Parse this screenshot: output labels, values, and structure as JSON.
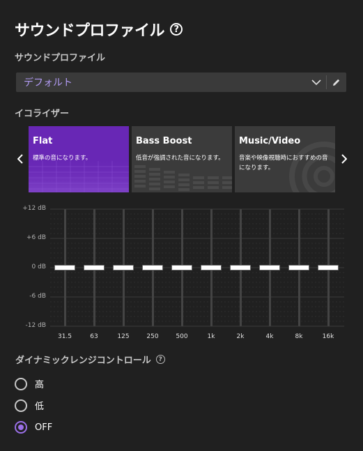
{
  "header": {
    "title": "サウンドプロファイル"
  },
  "profile": {
    "label": "サウンドプロファイル",
    "selected": "デフォルト"
  },
  "equalizer": {
    "label": "イコライザー",
    "presets": [
      {
        "name": "Flat",
        "desc": "標準の音になります。",
        "active": true
      },
      {
        "name": "Bass Boost",
        "desc": "低音が強調された音になります。",
        "active": false
      },
      {
        "name": "Music/Video",
        "desc": "音楽や映像視聴時におすすめの音になります。",
        "active": false
      }
    ],
    "y_ticks": [
      "+12 dB",
      "+6 dB",
      "0 dB",
      "-6 dB",
      "-12 dB"
    ],
    "bands": [
      {
        "freq": "31.5",
        "gain_db": 0
      },
      {
        "freq": "63",
        "gain_db": 0
      },
      {
        "freq": "125",
        "gain_db": 0
      },
      {
        "freq": "250",
        "gain_db": 0
      },
      {
        "freq": "500",
        "gain_db": 0
      },
      {
        "freq": "1k",
        "gain_db": 0
      },
      {
        "freq": "2k",
        "gain_db": 0
      },
      {
        "freq": "4k",
        "gain_db": 0
      },
      {
        "freq": "8k",
        "gain_db": 0
      },
      {
        "freq": "16k",
        "gain_db": 0
      }
    ],
    "range_db": [
      -12,
      12
    ]
  },
  "drc": {
    "label": "ダイナミックレンジコントロール",
    "options": [
      {
        "label": "高",
        "checked": false
      },
      {
        "label": "低",
        "checked": false
      },
      {
        "label": "OFF",
        "checked": true
      }
    ]
  },
  "colors": {
    "accent": "#6827b5",
    "accent_text": "#b39cf5",
    "radio_checked": "#9b70e8"
  }
}
